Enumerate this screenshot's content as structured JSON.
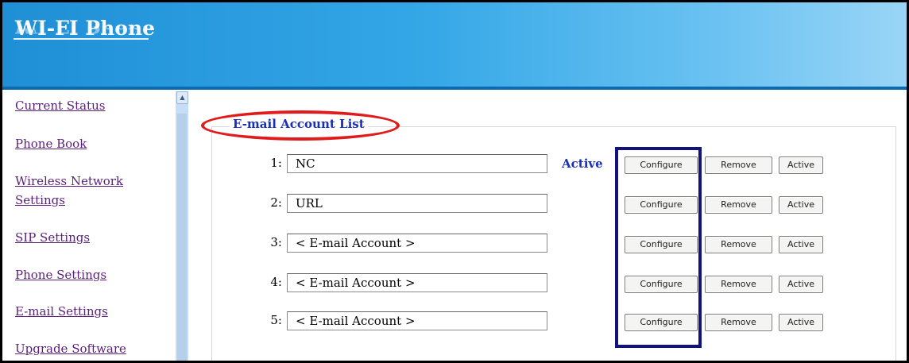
{
  "header": {
    "logo_text": "WI-FI Phone"
  },
  "sidebar": {
    "items": [
      {
        "label": "Current Status"
      },
      {
        "label": "Phone Book"
      },
      {
        "label": "Wireless Network"
      },
      {
        "label": "Settings"
      },
      {
        "label": "SIP Settings"
      },
      {
        "label": "Phone Settings"
      },
      {
        "label": "E-mail Settings"
      },
      {
        "label": "Upgrade Software"
      }
    ]
  },
  "panel": {
    "title": "E-mail Account List",
    "active_label": "Active",
    "buttons": {
      "configure": "Configure",
      "remove": "Remove",
      "active": "Active"
    },
    "accounts": [
      {
        "num": "1:",
        "value": "NC"
      },
      {
        "num": "2:",
        "value": "URL"
      },
      {
        "num": "3:",
        "value": "< E-mail Account >"
      },
      {
        "num": "4:",
        "value": "< E-mail Account >"
      },
      {
        "num": "5:",
        "value": "< E-mail Account >"
      }
    ]
  },
  "colors": {
    "header_blue": "#32a6e6",
    "title_blue": "#1a2fb8",
    "link_purple": "#5a1f7a",
    "highlight_red": "#e01b1b",
    "highlight_navy": "#12127a"
  }
}
